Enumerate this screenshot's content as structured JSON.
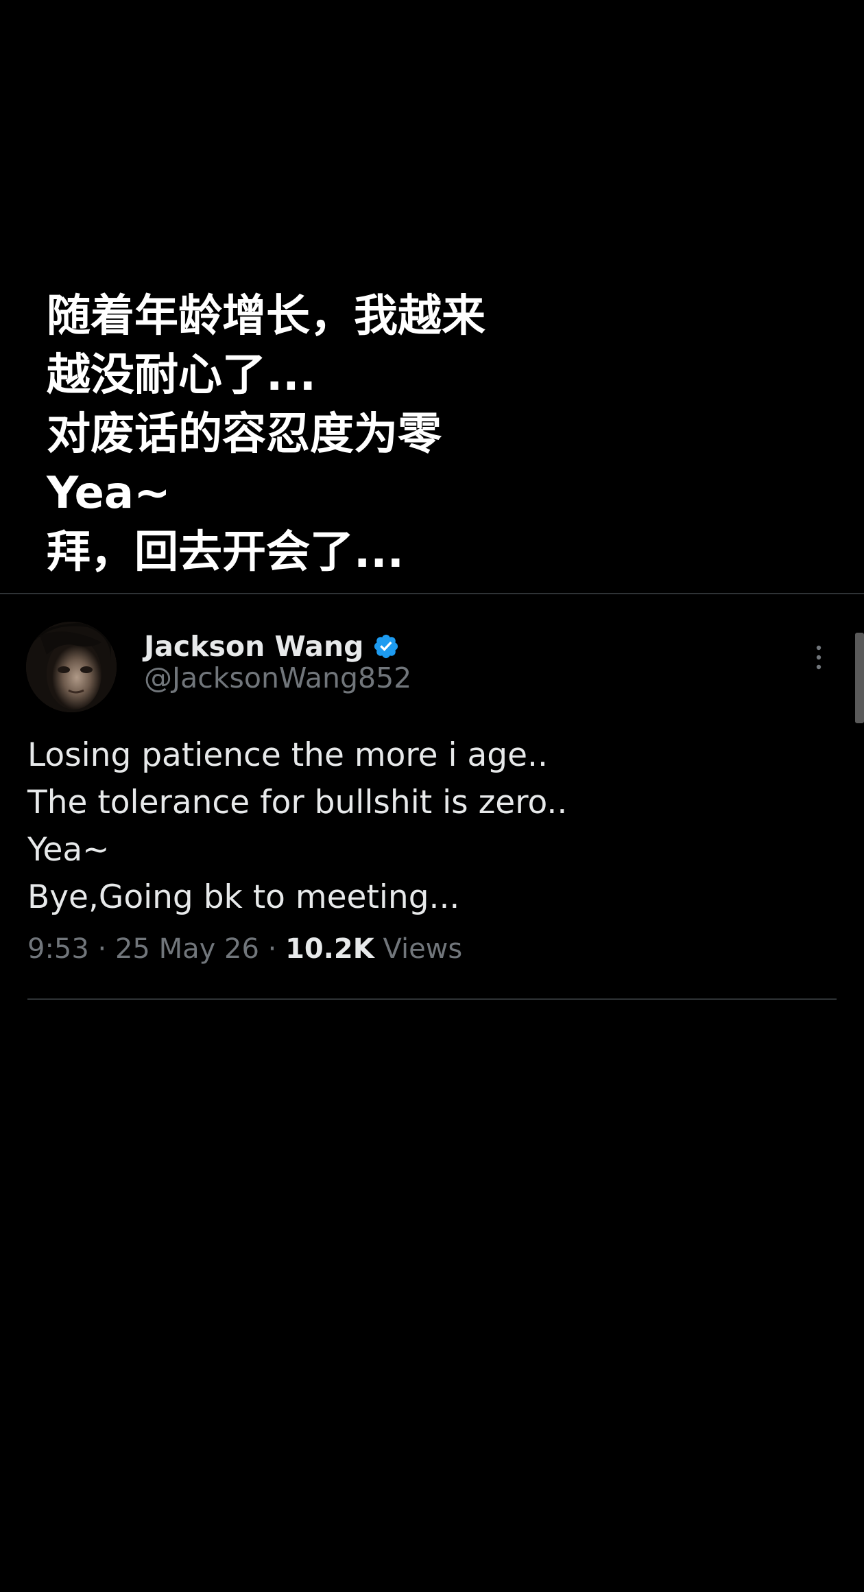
{
  "caption": {
    "lines": [
      "随着年龄增长，我越来",
      "越没耐心了...",
      "对废话的容忍度为零",
      "Yea~",
      "拜，回去开会了..."
    ]
  },
  "tweet": {
    "author": {
      "display_name": "Jackson Wang",
      "handle": "@JacksonWang852",
      "verified": true,
      "avatar_icon": "avatar-photo"
    },
    "text_lines": [
      "Losing patience the more i age..",
      "The tolerance for bullshit is zero..",
      "Yea~",
      "Bye,Going bk to meeting..."
    ],
    "time": "9:53",
    "separator": "·",
    "date": "25 May 26",
    "views_count": "10.2K",
    "views_label": "Views",
    "more_icon": "more-vertical-icon",
    "verified_icon": "verified-badge-icon"
  },
  "colors": {
    "background": "#000000",
    "primary_text": "#e7e9ea",
    "secondary_text": "#71767b",
    "verified_blue": "#1d9bf0",
    "divider": "#2f3336"
  }
}
